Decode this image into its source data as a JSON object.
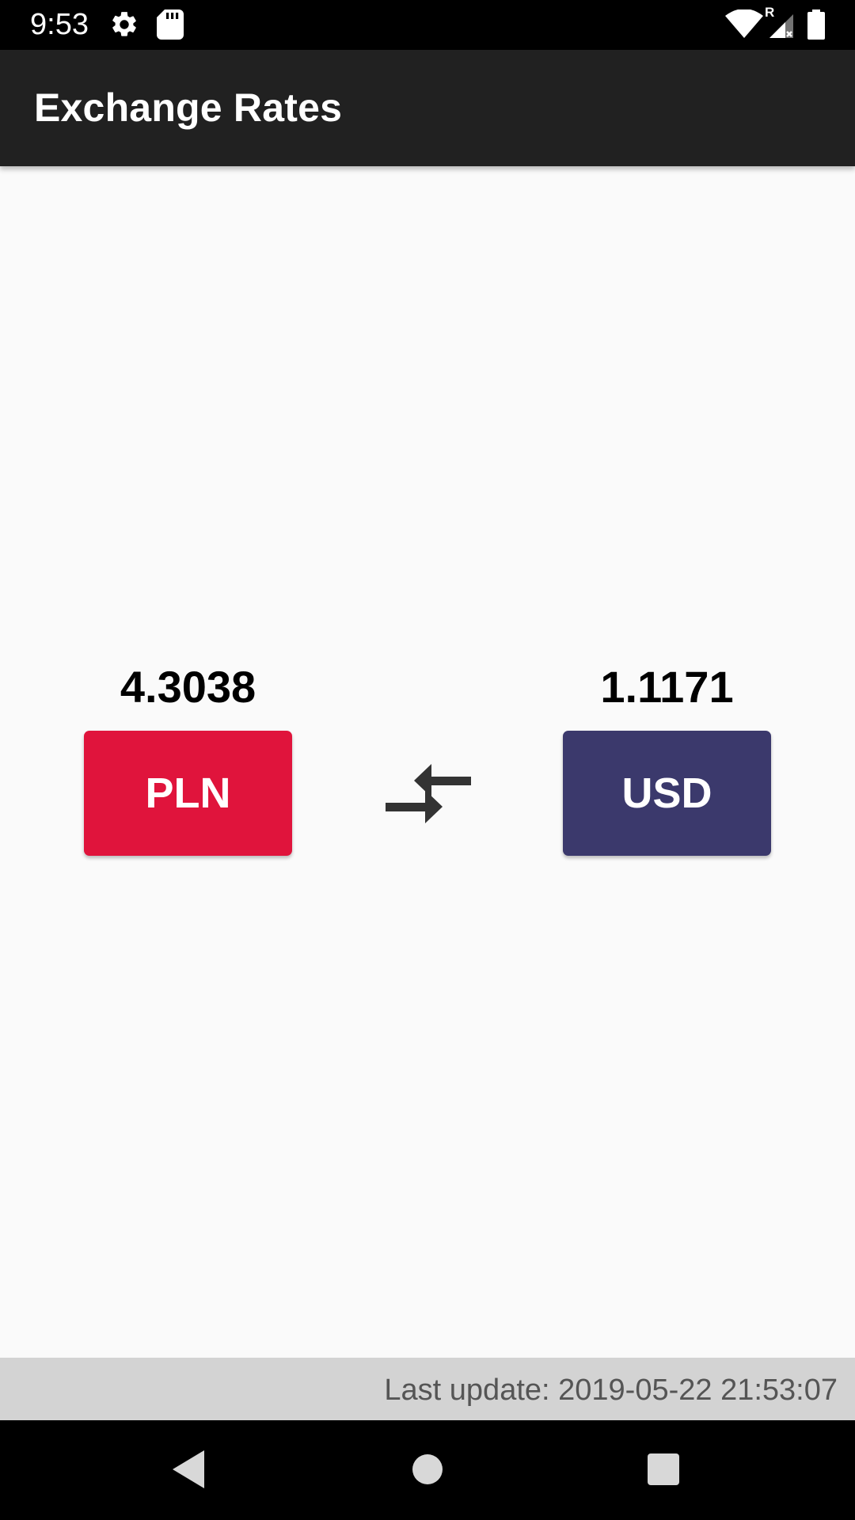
{
  "status_bar": {
    "time": "9:53",
    "icons": [
      "gear-icon",
      "sd-card-icon",
      "wifi-icon",
      "signal-roaming-icon",
      "battery-icon"
    ],
    "roaming_label": "R"
  },
  "app_bar": {
    "title": "Exchange Rates",
    "background": "#212121"
  },
  "rates": {
    "left": {
      "value": "4.3038",
      "currency": "PLN",
      "color": "#e0143c"
    },
    "right": {
      "value": "1.1171",
      "currency": "USD",
      "color": "#3b396c"
    },
    "swap_icon": "swap-arrows-icon"
  },
  "footer": {
    "last_update": "Last update: 2019-05-22 21:53:07"
  },
  "nav_bar": {
    "buttons": [
      "back-icon",
      "home-icon",
      "recents-icon"
    ]
  }
}
